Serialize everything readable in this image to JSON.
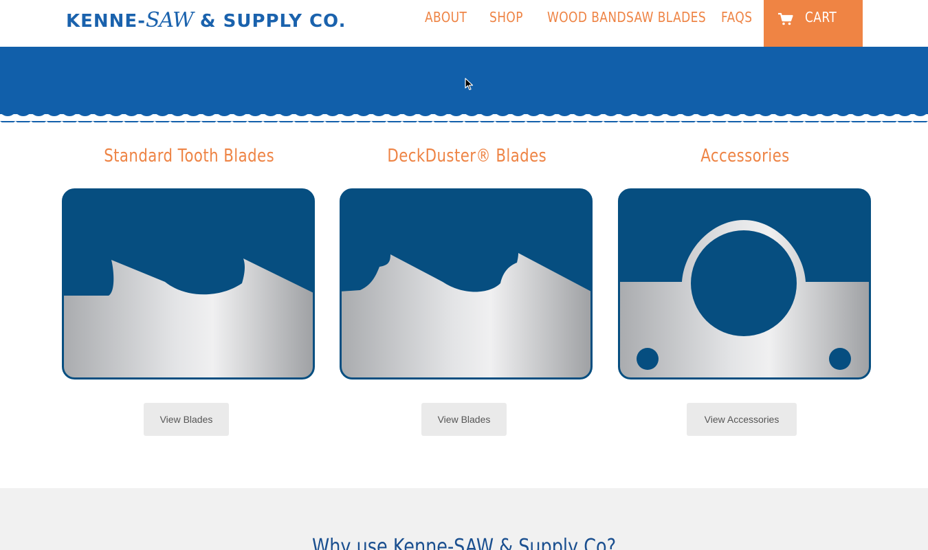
{
  "header": {
    "logo": {
      "part1": "KENNE-",
      "part2": "SAW",
      "part3": " & SUPPLY CO."
    },
    "nav": [
      {
        "label": "ABOUT"
      },
      {
        "label": "SHOP"
      },
      {
        "label": "WOOD BANDSAW BLADES"
      },
      {
        "label": "FAQS"
      }
    ],
    "cart": {
      "label": "CART",
      "icon": "cart-icon"
    }
  },
  "colors": {
    "brand_blue": "#1a62ad",
    "hero_blue": "#115faa",
    "card_blue": "#064e80",
    "accent_orange": "#ef8444",
    "section_gray": "#f1f1f1"
  },
  "categories": [
    {
      "title": "Standard Tooth Blades",
      "button": "View Blades",
      "icon": "standard-tooth-blade-icon"
    },
    {
      "title": "DeckDuster® Blades",
      "button": "View Blades",
      "icon": "deckduster-blade-icon"
    },
    {
      "title": "Accessories",
      "button": "View Accessories",
      "icon": "accessory-plate-icon"
    }
  ],
  "why": {
    "title": "Why use Kenne-SAW & Supply Co?"
  }
}
